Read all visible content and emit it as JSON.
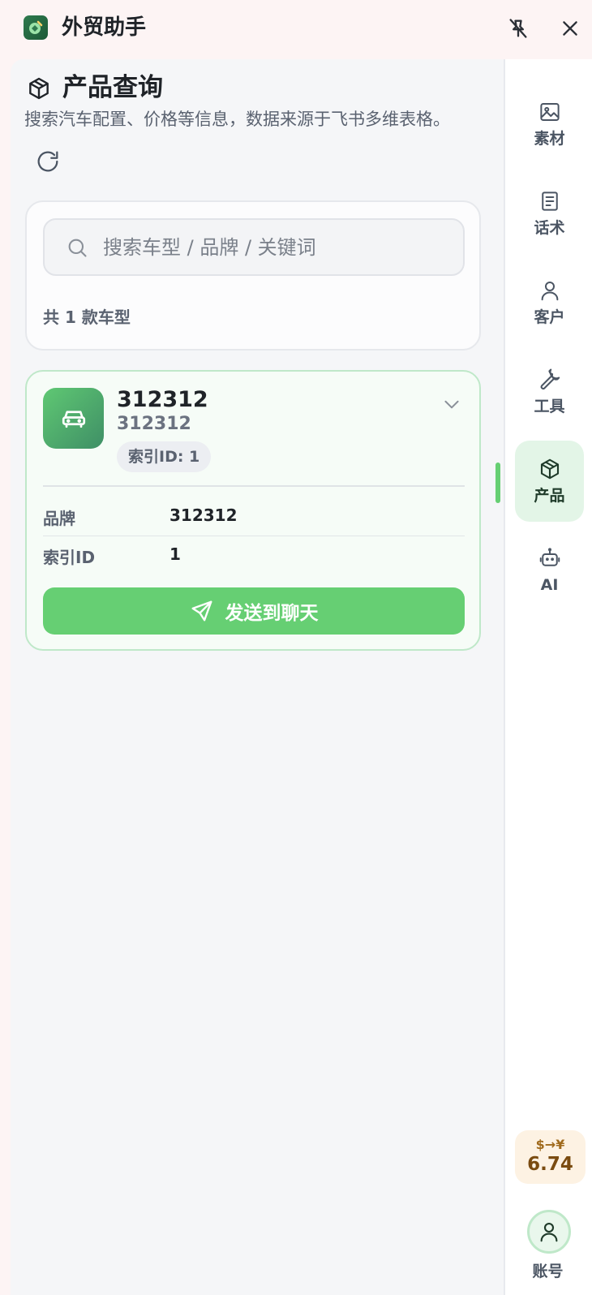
{
  "app": {
    "title": "外贸助手"
  },
  "header": {
    "title": "产品查询",
    "subtitle": "搜索汽车配置、价格等信息，数据来源于飞书多维表格。"
  },
  "search": {
    "placeholder": "搜索车型 / 品牌 / 关键词",
    "value": ""
  },
  "results": {
    "count_label": "共 1 款车型"
  },
  "product": {
    "name": "312312",
    "subtitle": "312312",
    "badge": "索引ID: 1",
    "fields": [
      {
        "key": "品牌",
        "value": "312312"
      },
      {
        "key": "索引ID",
        "value": "1"
      }
    ],
    "send_label": "发送到聊天"
  },
  "sidebar": {
    "items": [
      {
        "label": "素材",
        "icon": "image-icon"
      },
      {
        "label": "话术",
        "icon": "document-icon"
      },
      {
        "label": "客户",
        "icon": "user-icon"
      },
      {
        "label": "工具",
        "icon": "wrench-icon"
      },
      {
        "label": "产品",
        "icon": "box-icon",
        "active": true
      },
      {
        "label": "AI",
        "icon": "robot-icon"
      }
    ],
    "rate": {
      "label": "$→¥",
      "value": "6.74"
    },
    "account_label": "账号"
  },
  "colors": {
    "accent": "#66cf73",
    "active_bg": "#e3f5e7",
    "rate_bg": "#fdf2e3"
  }
}
